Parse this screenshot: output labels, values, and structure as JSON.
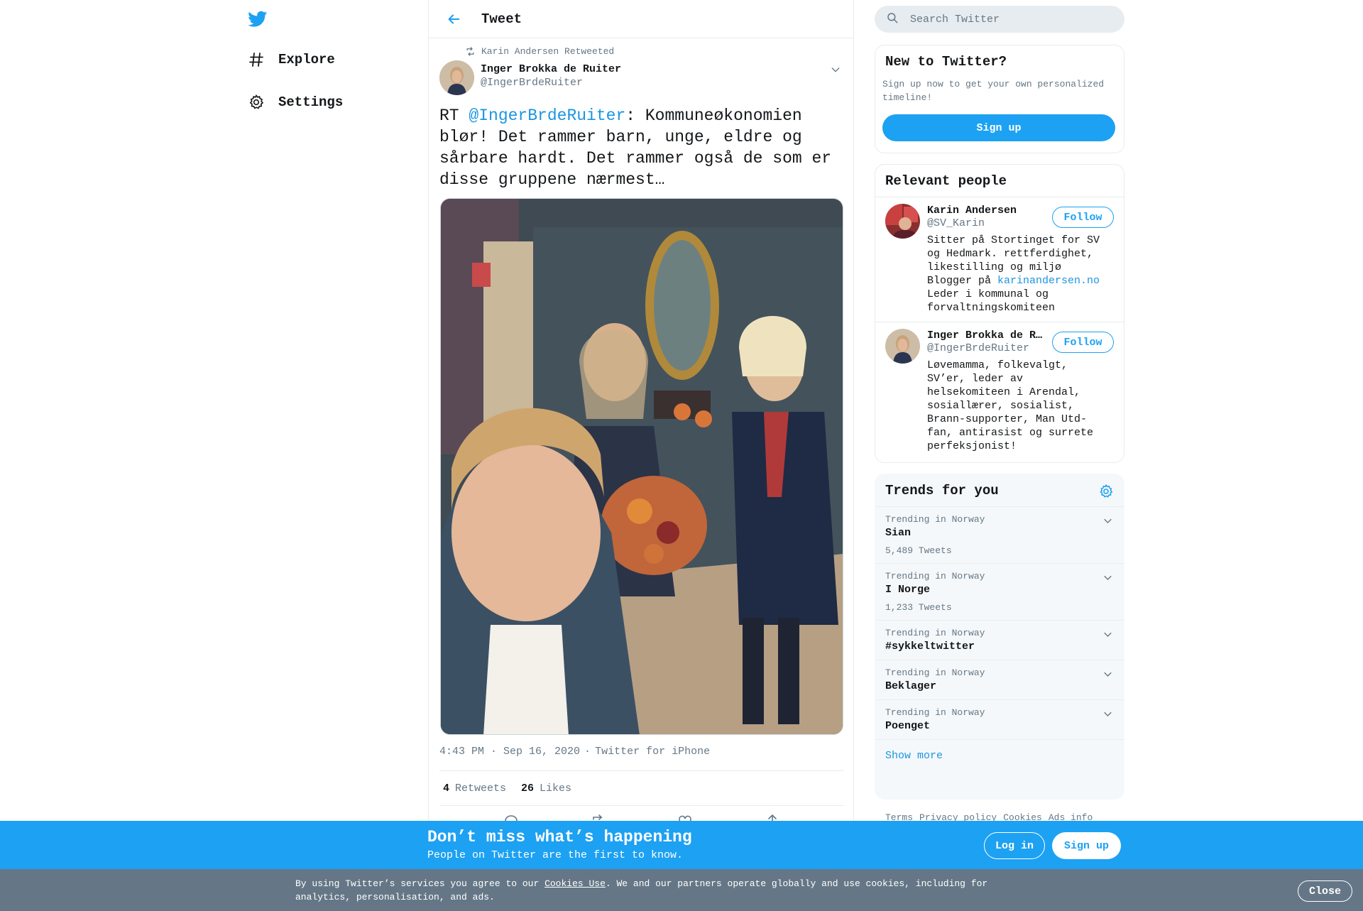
{
  "nav": {
    "logo_icon": "twitter-bird-icon",
    "items": [
      {
        "label": "Explore",
        "icon": "hashtag-icon"
      },
      {
        "label": "Settings",
        "icon": "gear-icon"
      }
    ]
  },
  "header": {
    "title": "Tweet",
    "back_icon": "arrow-left-icon"
  },
  "tweet": {
    "retweeted_by": "Karin Andersen Retweeted",
    "author_name": "Inger Brokka de Ruiter",
    "author_handle": "@IngerBrdeRuiter",
    "text_prefix": "RT ",
    "mention": "@IngerBrdeRuiter",
    "text_body": ": Kommuneøkonomien blør! Det rammer barn, unge, eldre og sårbare hardt. Det rammer også de som er disse gruppene nærmest…",
    "time": "4:43 PM · Sep 16, 2020",
    "separator": "·",
    "source": "Twitter for iPhone",
    "retweets_count": "4",
    "retweets_label": "Retweets",
    "likes_count": "26",
    "likes_label": "Likes"
  },
  "search": {
    "placeholder": "Search Twitter"
  },
  "new_to_twitter": {
    "title": "New to Twitter?",
    "desc": "Sign up now to get your own personalized timeline!",
    "button": "Sign up"
  },
  "relevant_people": {
    "title": "Relevant people",
    "people": [
      {
        "name": "Karin Andersen",
        "handle": "@SV_Karin",
        "bio_before": "Sitter på Stortinget for SV og Hedmark. rettferdighet, likestilling og miljø\nBlogger på ",
        "bio_link": "karinandersen.no",
        "bio_after": "\nLeder i kommunal og forvaltningskomiteen",
        "follow": "Follow"
      },
      {
        "name": "Inger Brokka de Ruiter",
        "handle": "@IngerBrdeRuiter",
        "bio_before": "Løvemamma, folkevalgt, SV’er, leder av helsekomiteen i Arendal, sosiallærer, sosialist, Brann-supporter, Man Utd-fan, antirasist og surrete perfeksjonist!",
        "bio_link": "",
        "bio_after": "",
        "follow": "Follow"
      }
    ]
  },
  "trends": {
    "title": "Trends for you",
    "items": [
      {
        "context": "Trending in Norway",
        "name": "Sian",
        "count": "5,489 Tweets"
      },
      {
        "context": "Trending in Norway",
        "name": "I Norge",
        "count": "1,233 Tweets"
      },
      {
        "context": "Trending in Norway",
        "name": "#sykkeltwitter",
        "count": ""
      },
      {
        "context": "Trending in Norway",
        "name": "Beklager",
        "count": ""
      },
      {
        "context": "Trending in Norway",
        "name": "Poenget",
        "count": ""
      }
    ],
    "show_more": "Show more"
  },
  "footer": {
    "links": [
      "Terms",
      "Privacy policy",
      "Cookies",
      "Ads info"
    ]
  },
  "cta": {
    "title": "Don’t miss what’s happening",
    "subtitle": "People on Twitter are the first to know.",
    "login": "Log in",
    "signup": "Sign up"
  },
  "cookie": {
    "before": "By using Twitter’s services you agree to our ",
    "link": "Cookies Use",
    "after": ". We and our partners operate globally and use cookies, including for analytics, personalisation, and ads.",
    "close": "Close"
  },
  "colors": {
    "brand": "#1da1f2",
    "link": "#1b95e0",
    "secondary_text": "#657786",
    "cookie_bar": "#657786"
  }
}
